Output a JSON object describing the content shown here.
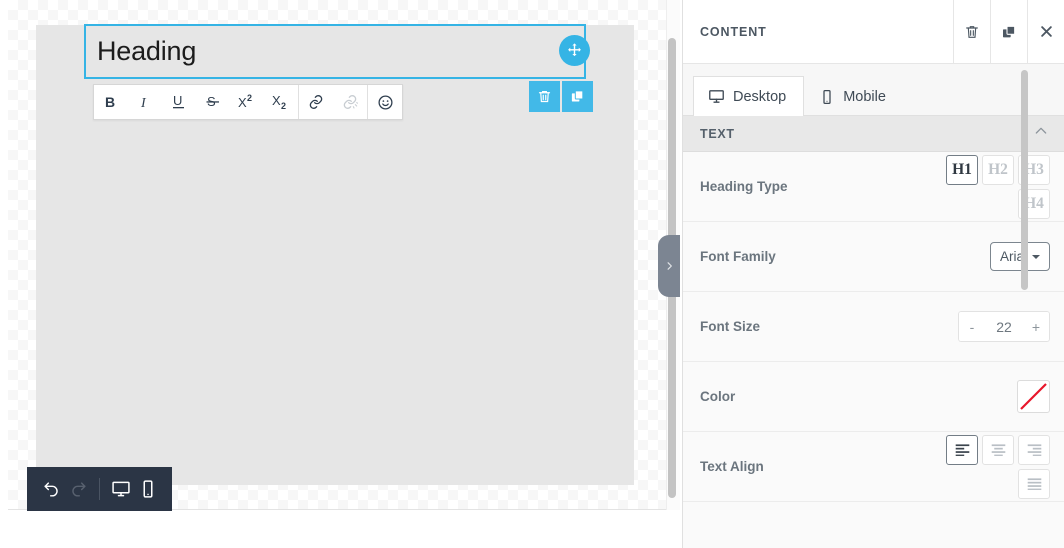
{
  "canvas": {
    "heading": {
      "text": "Heading"
    },
    "drag_handle_icon": "move-icon",
    "editor_toolbar": [
      {
        "name": "bold",
        "label": "B",
        "icon": "bold-icon",
        "disabled": false
      },
      {
        "name": "italic",
        "label": "I",
        "icon": "italic-icon",
        "disabled": false
      },
      {
        "name": "underline",
        "label": "U",
        "icon": "underline-icon",
        "disabled": false
      },
      {
        "name": "strikethrough",
        "label": "S",
        "icon": "strikethrough-icon",
        "disabled": false
      },
      {
        "name": "superscript",
        "label": "X²",
        "icon": "superscript-icon",
        "disabled": false
      },
      {
        "name": "subscript",
        "label": "X₂",
        "icon": "subscript-icon",
        "disabled": false
      },
      {
        "name": "link",
        "label": "",
        "icon": "link-icon",
        "disabled": false
      },
      {
        "name": "unlink",
        "label": "",
        "icon": "unlink-icon",
        "disabled": true
      },
      {
        "name": "emoji",
        "label": "",
        "icon": "smiley-icon",
        "disabled": false
      }
    ],
    "block_actions": [
      {
        "name": "delete",
        "icon": "trash-icon"
      },
      {
        "name": "duplicate",
        "icon": "duplicate-icon"
      }
    ],
    "bottom_toolbar": [
      {
        "name": "undo",
        "icon": "undo-icon",
        "disabled": false
      },
      {
        "name": "redo",
        "icon": "redo-icon",
        "disabled": true
      },
      {
        "name": "desktop-preview",
        "icon": "desktop-icon",
        "disabled": false
      },
      {
        "name": "mobile-preview",
        "icon": "mobile-icon",
        "disabled": false
      }
    ],
    "panel_toggle_icon": "chevron-right-icon"
  },
  "panel": {
    "title": "CONTENT",
    "header_actions": [
      {
        "name": "delete",
        "icon": "trash-icon"
      },
      {
        "name": "duplicate",
        "icon": "duplicate-icon"
      },
      {
        "name": "close",
        "icon": "close-icon"
      }
    ],
    "tabs": [
      {
        "label": "Desktop",
        "icon": "desktop-icon",
        "active": true
      },
      {
        "label": "Mobile",
        "icon": "mobile-icon",
        "active": false
      }
    ],
    "section": {
      "label": "TEXT",
      "collapse_icon": "chevron-up-icon",
      "expanded": true
    },
    "properties": {
      "heading_type": {
        "label": "Heading Type",
        "options": [
          "H1",
          "H2",
          "H3",
          "H4"
        ],
        "selected": "H1"
      },
      "font_family": {
        "label": "Font Family",
        "value": "Arial"
      },
      "font_size": {
        "label": "Font Size",
        "value": "22",
        "decrement_label": "-",
        "increment_label": "+"
      },
      "color": {
        "label": "Color",
        "value": "none",
        "swatch_background": "#ffffff",
        "slash_color": "#e8162b"
      },
      "text_align": {
        "label": "Text Align",
        "options": [
          "left",
          "center",
          "right",
          "justify"
        ],
        "selected": "left"
      }
    }
  },
  "colors": {
    "accent_blue": "#35b4e5",
    "action_blue": "#42b9e8",
    "dark_toolbar": "#2b3545",
    "panel_header_text": "#4c5762"
  }
}
